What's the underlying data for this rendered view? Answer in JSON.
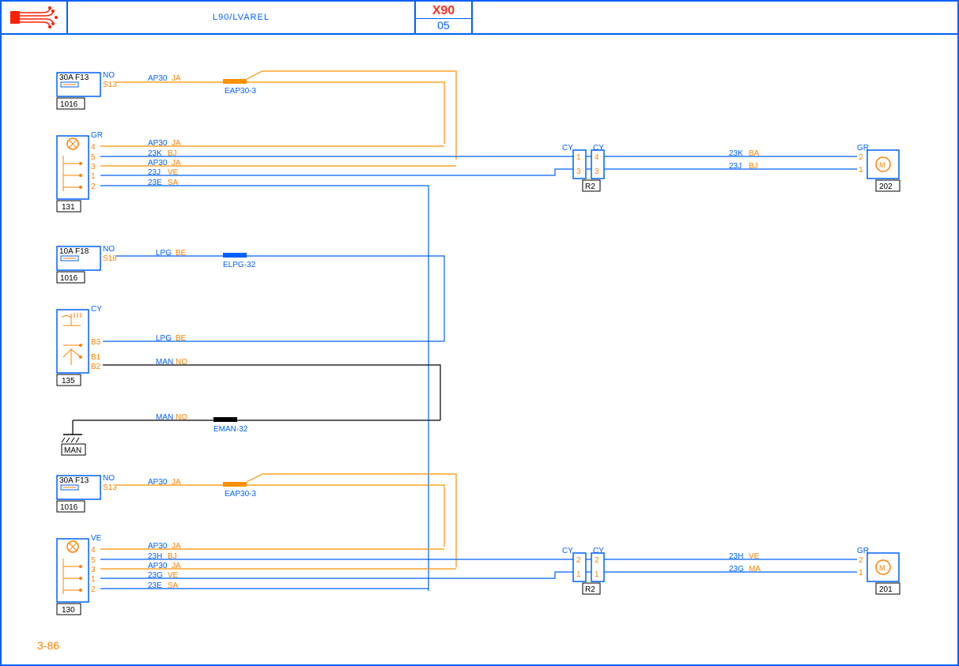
{
  "header": {
    "title": "L90/LVAREL",
    "code": "X90",
    "subcode": "05"
  },
  "page_number": "3-86",
  "components": {
    "f1016a": {
      "fuse": "30A  F13",
      "pin_label": "NO",
      "pin_num": "S13",
      "id": "1016"
    },
    "f1016b": {
      "fuse": "10A  F18",
      "pin_label": "NO",
      "pin_num": "S18",
      "id": "1016"
    },
    "f1016c": {
      "fuse": "30A  F13",
      "pin_label": "NO",
      "pin_num": "S13",
      "id": "1016"
    },
    "c131": {
      "conn_color": "GR",
      "pins": [
        "4",
        "5",
        "3",
        "1",
        "2"
      ],
      "id": "131"
    },
    "c135": {
      "conn_color": "CY",
      "pins": [
        "B3",
        "B1",
        "B2"
      ],
      "id": "135"
    },
    "c130": {
      "conn_color": "VE",
      "pins": [
        "4",
        "5",
        "3",
        "1",
        "2"
      ],
      "id": "130"
    },
    "r2a": {
      "id": "R2",
      "left_color": "CY",
      "right_color": "CY",
      "lpins": [
        "1",
        "3"
      ],
      "rpins": [
        "4",
        "3"
      ]
    },
    "r2b": {
      "id": "R2",
      "left_color": "CY",
      "right_color": "CY",
      "lpins": [
        "2",
        "1"
      ],
      "rpins": [
        "2",
        "1"
      ]
    },
    "c202": {
      "conn_color": "GR",
      "pins": [
        "2",
        "1"
      ],
      "id": "202"
    },
    "c201": {
      "conn_color": "GR",
      "pins": [
        "2",
        "1"
      ],
      "id": "201"
    },
    "man": {
      "id": "MAN"
    }
  },
  "wires": {
    "w1": {
      "sig": "AP30",
      "col": "JA"
    },
    "w2": {
      "sig": "23K",
      "col": "BJ"
    },
    "w3": {
      "sig": "AP30",
      "col": "JA"
    },
    "w4": {
      "sig": "23J",
      "col": "VE"
    },
    "w5": {
      "sig": "23E",
      "col": "SA"
    },
    "w6": {
      "sig": "23K",
      "col": "BA"
    },
    "w7": {
      "sig": "23J",
      "col": "BJ"
    },
    "w8": {
      "sig": "LPG",
      "col": "BE"
    },
    "w9": {
      "sig": "LPG",
      "col": "BE"
    },
    "w10": {
      "sig": "MAN",
      "col": "NO"
    },
    "w11": {
      "sig": "MAN",
      "col": "NO"
    },
    "w12": {
      "sig": "AP30",
      "col": "JA"
    },
    "w13": {
      "sig": "AP30",
      "col": "JA"
    },
    "w14": {
      "sig": "23H",
      "col": "BJ"
    },
    "w15": {
      "sig": "AP30",
      "col": "JA"
    },
    "w16": {
      "sig": "23G",
      "col": "VE"
    },
    "w17": {
      "sig": "23E",
      "col": "SA"
    },
    "w18": {
      "sig": "23H",
      "col": "VE"
    },
    "w19": {
      "sig": "23G",
      "col": "MA"
    }
  },
  "splices": {
    "s1": "EAP30-3",
    "s2": "ELPG-32",
    "s3": "EMAN-32",
    "s4": "EAP30-3"
  }
}
